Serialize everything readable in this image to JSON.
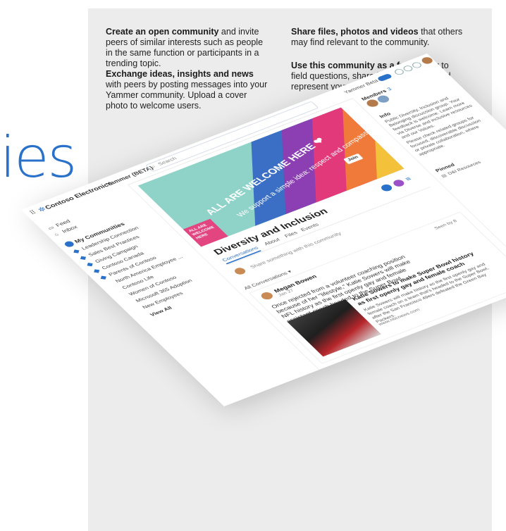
{
  "page": {
    "title_fragment": "ies"
  },
  "features": [
    {
      "bold": "Create an open community",
      "rest": " and invite peers of similar interests such as people in the same function or participants in a trending topic."
    },
    {
      "bold": "Exchange ideas, insights and news",
      "rest": " with peers by posting messages into your Yammer community. Upload a cover photo to welcome users."
    },
    {
      "bold": "Share files, photos and videos",
      "rest": " that others may find relevant to the community."
    },
    {
      "bold": "Use this community as a front door",
      "rest": " to field questions, share best practices, and represent your interests to the organization"
    }
  ],
  "app": {
    "brand": "Contoso Electronics",
    "brand_sub": "Yammer (BETA)",
    "search_placeholder": "Search",
    "toggle_label": "Yammer Beta",
    "nav": {
      "feed": "Feed",
      "inbox": "Inbox",
      "my_communities": "My Communities",
      "communities": [
        "Leadership Connection",
        "Sales Best Practices",
        "Giving Campaign",
        "Contoso Canada",
        "Parents of Contoso",
        "North America Employee ...",
        "Contoso Life",
        "Women of Contoso",
        "Microsoft 365 Adoption",
        "New Employees"
      ],
      "view_all": "View All"
    },
    "banner": {
      "headline": "ALL ARE WELCOME HERE ❤",
      "subline": "We support a simple idea: respect and compassion for all.",
      "logo_text": "ALL ARE WELCOME HERE",
      "join": "Join"
    },
    "group": {
      "title": "Diversity and Inclusion",
      "tabs": [
        "Conversations",
        "About",
        "Files",
        "Events"
      ]
    },
    "composer": {
      "placeholder": "Share something with this community"
    },
    "filter": "All Conversations",
    "post": {
      "author": "Megan Bowen",
      "date": "Jan 27",
      "seen": "Seen by 8",
      "body": "Once rejected from a volunteer coaching position because of her \"lifestyle,\" Katie Sowers will make NFL history as the first openly gay and female assistant coach headed to the Super Bowl.",
      "link_title": "Katie Sowers to make Super Bowl history as first openly gay and female coach",
      "link_desc": "Katie Sowers will make history as the first openly gay and female coach on a team that's headed to the Super Bowl, after the San Francisco 49ers defeated the Green Bay Packers.",
      "link_url": "www.nbcnews.com"
    },
    "right": {
      "members_label": "Members",
      "members_count": "3",
      "info_label": "Info",
      "info_text": "Public Diversity, Inclusion and Belonging discussion group. Your feedback is welcome. Learn more via Diverse and inclusive resources and our Values.",
      "info_text2": "Please check related groups for focused, discoverable discussion or private collaboration, where appropriate.",
      "pinned_label": "Pinned",
      "pinned_item": "D&I Resources"
    }
  },
  "colors": {
    "accent": "#2a72c9",
    "panel": "#ececec",
    "banner": "#8fd3c8"
  }
}
